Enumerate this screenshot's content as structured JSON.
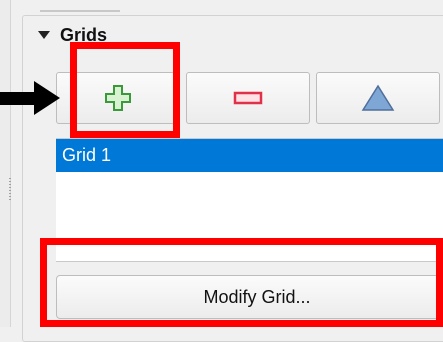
{
  "panel": {
    "title": "Grids",
    "grid_items": [
      {
        "label": "Grid 1",
        "selected": true
      }
    ],
    "modify_label": "Modify Grid...",
    "icons": {
      "add": "plus-icon",
      "remove": "minus-icon",
      "properties": "triangle-icon"
    },
    "colors": {
      "selection": "#0078d7",
      "highlight": "#ff0000",
      "add_icon": "#3a9a3a",
      "remove_icon": "#e0304a",
      "properties_icon": "#4f86c6"
    }
  }
}
